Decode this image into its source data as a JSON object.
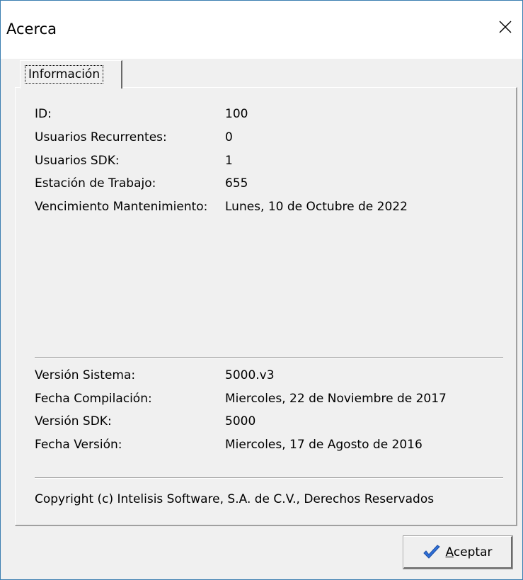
{
  "window": {
    "title": "Acerca"
  },
  "tabs": [
    {
      "label": "Información"
    }
  ],
  "info": [
    {
      "label": "ID:",
      "value": "100"
    },
    {
      "label": "Usuarios Recurrentes:",
      "value": "0"
    },
    {
      "label": "Usuarios SDK:",
      "value": "1"
    },
    {
      "label": "Estación de Trabajo:",
      "value": "655"
    },
    {
      "label": "Vencimiento Mantenimiento:",
      "value": "Lunes, 10 de Octubre de 2022"
    }
  ],
  "version": [
    {
      "label": "Versión Sistema:",
      "value": "5000.v3"
    },
    {
      "label": "Fecha Compilación:",
      "value": "Miercoles, 22 de Noviembre de 2017"
    },
    {
      "label": "Versión SDK:",
      "value": "5000"
    },
    {
      "label": "Fecha Versión:",
      "value": "Miercoles, 17 de Agosto de 2016"
    }
  ],
  "copyright": "Copyright (c) Intelisis Software, S.A. de C.V., Derechos Reservados",
  "buttons": {
    "accept_first": "A",
    "accept_rest": "ceptar",
    "accept_icon": "checkmark-icon"
  },
  "colors": {
    "window_border": "#3c7fb1",
    "face": "#f0f0f0",
    "check_blue": "#2f6fd8"
  }
}
